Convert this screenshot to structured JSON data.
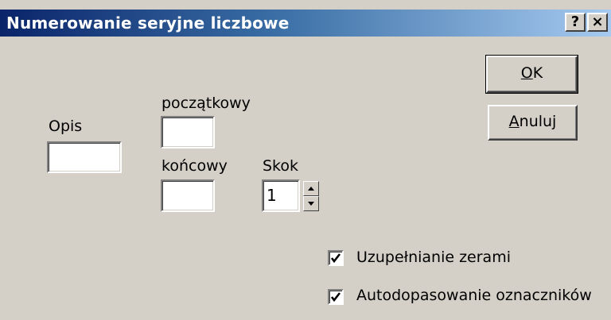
{
  "window": {
    "title": "Numerowanie seryjne liczbowe",
    "help_button": "?",
    "close_button": "×"
  },
  "fields": {
    "opis_label": "Opis",
    "opis_value": "",
    "poczatkowy_label": "początkowy",
    "poczatkowy_value": "",
    "koncowy_label": "końcowy",
    "koncowy_value": "",
    "skok_label": "Skok",
    "skok_value": "1"
  },
  "buttons": {
    "ok_mnemonic": "O",
    "ok_rest": "K",
    "cancel_mnemonic": "A",
    "cancel_rest": "nuluj"
  },
  "options": {
    "zero_padding_label": "Uzupełnianie zerami",
    "zero_padding_checked": true,
    "auto_fit_label": "Autodopasowanie oznaczników",
    "auto_fit_checked": true
  },
  "icons": {
    "spin_up": "up-arrow-icon",
    "spin_down": "down-arrow-icon",
    "checkmark": "checkmark-icon"
  }
}
